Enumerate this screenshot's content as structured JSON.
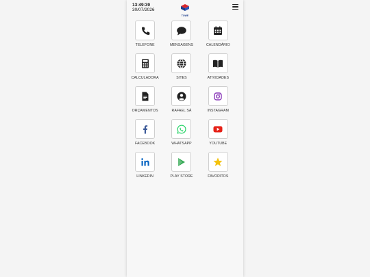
{
  "status": {
    "time": "13:49:39",
    "date": "30/07/2026"
  },
  "logo": {
    "text": "TOWE"
  },
  "menu_icon": "hamburger-menu-icon",
  "apps": [
    {
      "label": "TELEFONE",
      "icon": "phone-icon",
      "color": "#222222"
    },
    {
      "label": "MENSAGENS",
      "icon": "chat-bubble-icon",
      "color": "#222222"
    },
    {
      "label": "CALENDÁRIO",
      "icon": "calendar-icon",
      "color": "#222222"
    },
    {
      "label": "CALCULADORA",
      "icon": "calculator-icon",
      "color": "#222222"
    },
    {
      "label": "SITES",
      "icon": "globe-icon",
      "color": "#222222"
    },
    {
      "label": "ATIVIDADES",
      "icon": "book-icon",
      "color": "#222222"
    },
    {
      "label": "ORÇAMENTOS",
      "icon": "document-icon",
      "color": "#222222"
    },
    {
      "label": "RAFAEL SÁ",
      "icon": "user-circle-icon",
      "color": "#222222"
    },
    {
      "label": "INSTAGRAM",
      "icon": "instagram-icon",
      "color": "#8a3ab9"
    },
    {
      "label": "FACEBOOK",
      "icon": "facebook-icon",
      "color": "#3b5998"
    },
    {
      "label": "WHATSAPP",
      "icon": "whatsapp-icon",
      "color": "#25d366"
    },
    {
      "label": "YOUTUBE",
      "icon": "youtube-icon",
      "color": "#e62117"
    },
    {
      "label": "LINKEDIN",
      "icon": "linkedin-icon",
      "color": "#0a66c2"
    },
    {
      "label": "PLAY STORE",
      "icon": "play-store-icon",
      "color": "#34a853"
    },
    {
      "label": "FAVORITOS",
      "icon": "star-icon",
      "color": "#f4c20d"
    }
  ]
}
